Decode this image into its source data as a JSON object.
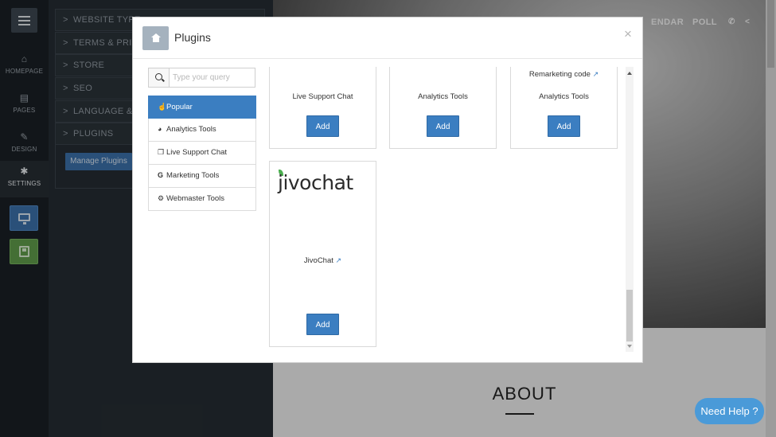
{
  "rail": {
    "items": [
      {
        "label": "HOMEPAGE",
        "icon": "home-icon"
      },
      {
        "label": "PAGES",
        "icon": "pages-icon"
      },
      {
        "label": "DESIGN",
        "icon": "brush-icon"
      },
      {
        "label": "SETTINGS",
        "icon": "gear-icon"
      }
    ]
  },
  "settings_panel": {
    "items": [
      {
        "label": "WEBSITE TYPE"
      },
      {
        "label": "TERMS & PRIVAC"
      },
      {
        "label": "STORE"
      },
      {
        "label": "SEO"
      },
      {
        "label": "LANGUAGE & C"
      },
      {
        "label": "PLUGINS"
      }
    ],
    "manage_plugins_label": "Manage Plugins"
  },
  "site": {
    "nav": {
      "calendar": "ENDAR",
      "poll": "POLL"
    },
    "about_heading": "ABOUT",
    "need_help_label": "Need Help ?"
  },
  "modal": {
    "title": "Plugins",
    "close_symbol": "×",
    "search": {
      "placeholder": "Type your query",
      "value": ""
    },
    "categories": [
      {
        "label": "Popular",
        "active": true
      },
      {
        "label": "Analytics Tools",
        "active": false
      },
      {
        "label": "Live Support Chat",
        "active": false
      },
      {
        "label": "Marketing Tools",
        "active": false
      },
      {
        "label": "Webmaster Tools",
        "active": false
      }
    ],
    "cards": [
      {
        "name": "Live Support Chat",
        "add_label": "Add"
      },
      {
        "name": "Analytics Tools",
        "add_label": "Add"
      },
      {
        "top_label": "Remarketing code",
        "name": "Analytics Tools",
        "add_label": "Add"
      },
      {
        "logo_text": "jivochat",
        "name": "JivoChat",
        "add_label": "Add"
      }
    ]
  },
  "colors": {
    "accent": "#3b7ec1",
    "rail_bg": "#1a1f24",
    "panel_bg": "#252c32",
    "need_help": "#4a9ad8"
  }
}
